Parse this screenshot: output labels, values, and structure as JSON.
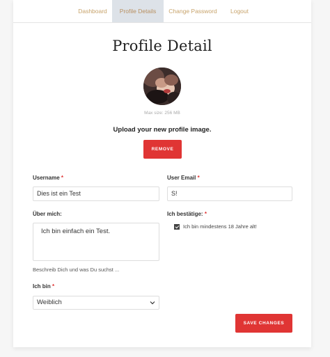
{
  "nav": {
    "tabs": [
      {
        "label": "Dashboard"
      },
      {
        "label": "Profile Details"
      },
      {
        "label": "Change Password"
      },
      {
        "label": "Logout"
      }
    ],
    "active_index": 1
  },
  "page": {
    "title": "Profile Detail",
    "max_size": "Max size: 256 MB",
    "upload_text": "Upload your new profile image.",
    "remove_label": "REMOVE"
  },
  "form": {
    "username": {
      "label": "Username",
      "required": "*",
      "value": "Dies ist ein Test"
    },
    "email": {
      "label": "User Email",
      "required": "*",
      "value": "S!"
    },
    "about": {
      "label": "Über mich:",
      "value": "Ich bin einfach ein Test.",
      "help": "Beschreib Dich und was Du suchst ..."
    },
    "confirm": {
      "label": "Ich bestätige:",
      "required": "*",
      "checkbox_label": "Ich bin mindestens 18 Jahre alt!",
      "checked": true
    },
    "gender": {
      "label": "Ich bin",
      "required": "*",
      "value": "Weiblich"
    },
    "save_label": "SAVE CHANGES"
  },
  "colors": {
    "accent": "#e03534",
    "nav_text": "#c7a36b",
    "nav_active_bg": "#dde2e8"
  }
}
